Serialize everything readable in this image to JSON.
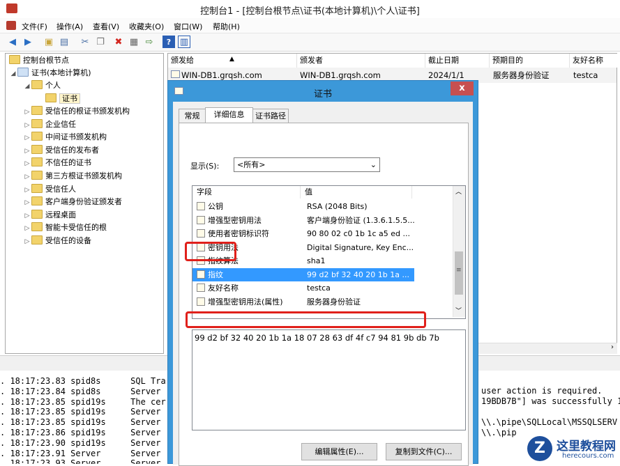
{
  "window": {
    "title": "控制台1 - [控制台根节点\\证书(本地计算机)\\个人\\证书]"
  },
  "menu": [
    "文件(F)",
    "操作(A)",
    "查看(V)",
    "收藏夹(O)",
    "窗口(W)",
    "帮助(H)"
  ],
  "toolbar": [
    "back-icon",
    "forward-icon",
    "up-folder-icon",
    "show-tree-icon",
    "cut-icon",
    "copy-icon",
    "delete-icon",
    "properties-icon",
    "export-icon",
    "help-icon",
    "view-icon"
  ],
  "tree": {
    "root": "控制台根节点",
    "store": "证书(本地计算机)",
    "personal": "个人",
    "certs": "证书",
    "folders": [
      "受信任的根证书颁发机构",
      "企业信任",
      "中间证书颁发机构",
      "受信任的发布者",
      "不信任的证书",
      "第三方根证书颁发机构",
      "受信任人",
      "客户端身份验证颁发者",
      "远程桌面",
      "智能卡受信任的根",
      "受信任的设备"
    ]
  },
  "list": {
    "columns": [
      "颁发给",
      "颁发者",
      "截止日期",
      "预期目的",
      "友好名称"
    ],
    "row": [
      "WIN-DB1.grqsh.com",
      "WIN-DB1.grqsh.com",
      "2024/1/1",
      "服务器身份验证",
      "testca"
    ]
  },
  "console": {
    "lines": [
      [
        ". 18:17:23.83",
        "spid8s",
        "SQL Tra"
      ],
      [
        ". 18:17:23.84",
        "spid8s",
        "Server"
      ],
      [
        ". 18:17:23.85",
        "spid19s",
        "The cer"
      ],
      [
        ". 18:17:23.85",
        "spid19s",
        "Server"
      ],
      [
        ". 18:17:23.85",
        "spid19s",
        "Server"
      ],
      [
        ". 18:17:23.86",
        "spid19s",
        "Server"
      ],
      [
        ". 18:17:23.90",
        "spid19s",
        "Server"
      ],
      [
        ". 18:17:23.91",
        "Server",
        "Server"
      ],
      [
        ". 18:17:23.93",
        "Server",
        "Server"
      ]
    ],
    "right_lines": [
      "user action is required.",
      "19BDB7B\"] was successfully 1",
      "",
      "\\\\.\\pipe\\SQLLocal\\MSSQLSERV",
      "\\\\.\\pip"
    ]
  },
  "dialog": {
    "title": "证书",
    "close": "x",
    "tabs": [
      "常规",
      "详细信息",
      "证书路径"
    ],
    "active_tab": 1,
    "show_label": "显示(S):",
    "show_value": "<所有>",
    "field_header": "字段",
    "value_header": "值",
    "fields": [
      {
        "name": "公钥",
        "value": "RSA (2048 Bits)"
      },
      {
        "name": "增强型密钥用法",
        "value": "客户端身份验证 (1.3.6.1.5.5..."
      },
      {
        "name": "使用者密钥标识符",
        "value": "90 80 02 c0 1b 1c a5 ed ..."
      },
      {
        "name": "密钥用法",
        "value": "Digital Signature, Key Enc..."
      },
      {
        "name": "指纹算法",
        "value": "sha1"
      },
      {
        "name": "指纹",
        "value": "99 d2 bf 32 40 20 1b 1a ..."
      },
      {
        "name": "友好名称",
        "value": "testca"
      },
      {
        "name": "增强型密钥用法(属性)",
        "value": "服务器身份验证"
      }
    ],
    "selected_index": 5,
    "detail_value": "99 d2 bf 32 40 20 1b 1a 18 07 28 63 df 4f c7 94 81 9b db 7b",
    "buttons": [
      "编辑属性(E)...",
      "复制到文件(C)..."
    ]
  },
  "watermark": {
    "text": "这里教程网",
    "url": "herecours.com"
  },
  "colors": {
    "selection": "#3399ff",
    "highlight": "#e0201b",
    "dialog_frame": "#3c98d9"
  }
}
